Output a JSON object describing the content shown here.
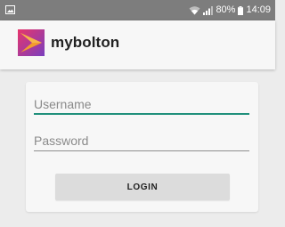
{
  "status_bar": {
    "battery": "80%",
    "time": "14:09"
  },
  "app_bar": {
    "title": "mybolton",
    "logo_icon": "mybolton-logo-icon"
  },
  "login_form": {
    "username_placeholder": "Username",
    "password_placeholder": "Password",
    "login_label": "LOGIN"
  },
  "colors": {
    "accent": "#21907c",
    "logo_gradient": [
      "#e8356b",
      "#7a3fbf"
    ]
  }
}
